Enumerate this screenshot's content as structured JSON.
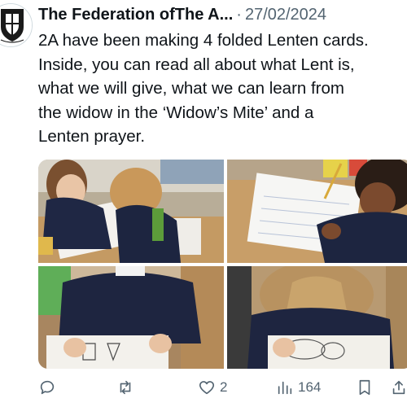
{
  "tweet": {
    "author_name": "The Federation ofThe A...",
    "separator": "·",
    "date": "27/02/2024",
    "text_lines": [
      "2A have been making 4 folded Lenten cards.",
      "Inside, you can read all about what Lent is,",
      "what we will give, what we can learn from",
      "the widow in the ‘Widow’s Mite’ and a",
      "Lenten prayer."
    ]
  },
  "actions": {
    "reply_count": "",
    "retweet_count": "",
    "like_count": "2",
    "views_count": "164"
  },
  "photos": [
    "children-writing-cards-1",
    "child-writing-card-2",
    "child-writing-card-3",
    "child-writing-card-4"
  ],
  "colors": {
    "text": "#0f1419",
    "secondary": "#536471",
    "accent": "#1d9bf0"
  },
  "icons": [
    "reply-icon",
    "retweet-icon",
    "like-icon",
    "views-icon",
    "bookmark-icon",
    "share-icon"
  ]
}
